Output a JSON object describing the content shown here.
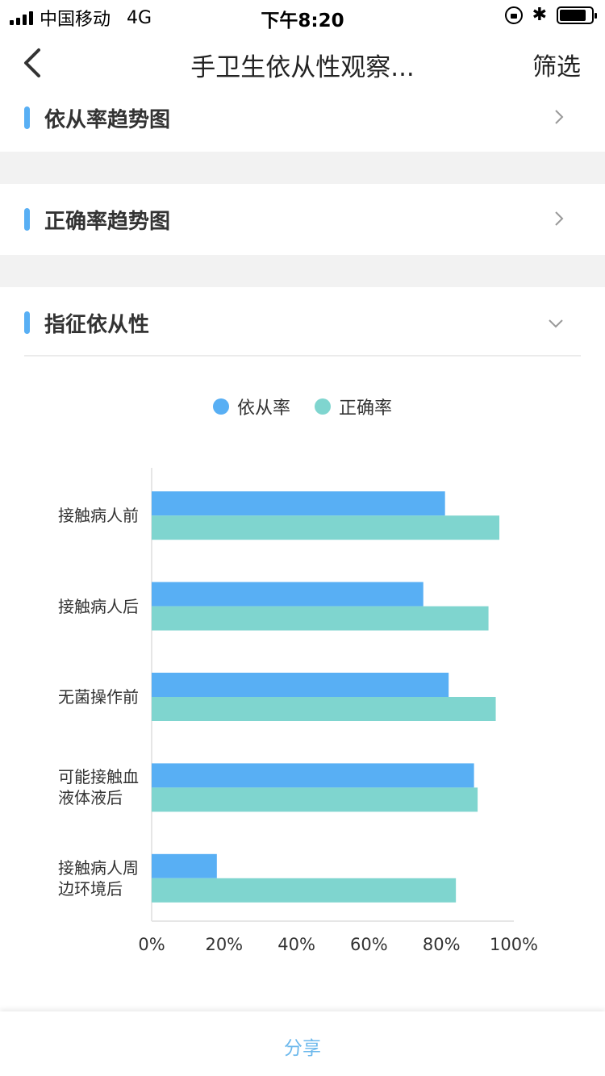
{
  "status_bar": {
    "carrier": "中国移动",
    "network": "4G",
    "time": "下午8:20",
    "battery_level": 0.85
  },
  "nav": {
    "title": "手卫生依从性观察...",
    "filter_label": "筛选"
  },
  "sections": {
    "compliance_trend": {
      "title": "依从率趋势图",
      "icon": "chevron-right-icon"
    },
    "accuracy_trend": {
      "title": "正确率趋势图",
      "icon": "chevron-right-icon"
    },
    "indication_compliance": {
      "title": "指征依从性",
      "icon": "chevron-down-icon"
    }
  },
  "colors": {
    "accent": "#58AFF4",
    "series_compliance": "#58AFF4",
    "series_accuracy": "#7FD5CF",
    "share_text": "#6cb8ec"
  },
  "chart_data": {
    "type": "bar",
    "orientation": "horizontal",
    "categories": [
      "接触病人前",
      "接触病人后",
      "无菌操作前",
      "可能接触血液体液后",
      "接触病人周边环境后"
    ],
    "category_lines": [
      [
        "接触病人前"
      ],
      [
        "接触病人后"
      ],
      [
        "无菌操作前"
      ],
      [
        "可能接触血",
        "液体液后"
      ],
      [
        "接触病人周",
        "边环境后"
      ]
    ],
    "series": [
      {
        "name": "依从率",
        "values": [
          81,
          75,
          82,
          89,
          18
        ]
      },
      {
        "name": "正确率",
        "values": [
          96,
          93,
          95,
          90,
          84
        ]
      }
    ],
    "xlim": [
      0,
      100
    ],
    "x_ticks": [
      "0%",
      "20%",
      "40%",
      "60%",
      "80%",
      "100%"
    ],
    "legend": "top"
  },
  "share": {
    "label": "分享"
  }
}
